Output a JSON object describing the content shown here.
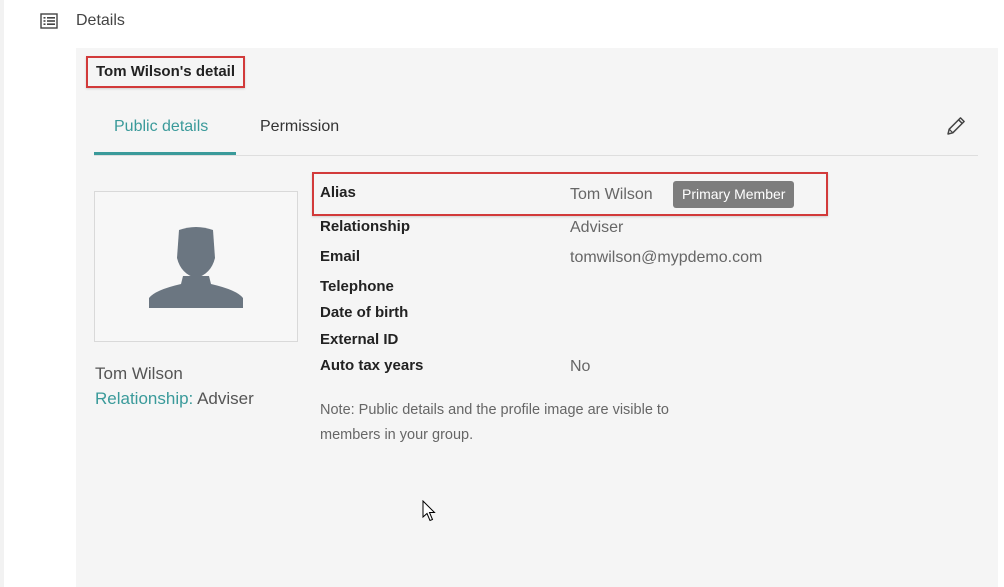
{
  "header": {
    "title": "Details",
    "icon": "list-icon"
  },
  "panel": {
    "title": "Tom Wilson's detail",
    "tabs": [
      {
        "label": "Public details",
        "active": true
      },
      {
        "label": "Permission",
        "active": false
      }
    ],
    "edit_icon": "pencil-icon"
  },
  "profile": {
    "avatar_icon": "user-silhouette-icon",
    "name": "Tom Wilson",
    "relationship_label": "Relationship:",
    "relationship_value": "Adviser"
  },
  "fields": [
    {
      "label": "Alias",
      "value": "Tom Wilson"
    },
    {
      "label": "Relationship",
      "value": "Adviser"
    },
    {
      "label": "Email",
      "value": "tomwilson@mypdemo.com"
    },
    {
      "label": "Telephone",
      "value": ""
    },
    {
      "label": "Date of birth",
      "value": ""
    },
    {
      "label": "External ID",
      "value": ""
    },
    {
      "label": "Auto tax years",
      "value": "No"
    }
  ],
  "badge": "Primary Member",
  "note": {
    "line1": "Note: Public details and the profile image are visible to",
    "line2": "members in your group."
  },
  "colors": {
    "accent": "#3a9a9a",
    "highlight": "#d23a3a",
    "badge": "#7d7d7d",
    "avatar": "#6b7681"
  }
}
